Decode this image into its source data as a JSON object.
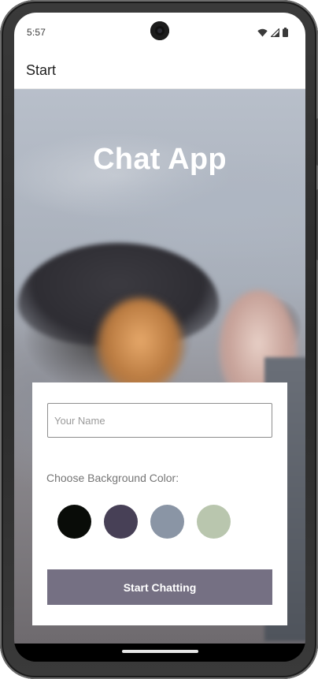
{
  "status_bar": {
    "time": "5:57",
    "icons": [
      "wifi-icon",
      "signal-icon",
      "battery-icon"
    ]
  },
  "app_bar": {
    "title": "Start"
  },
  "hero": {
    "title": "Chat App"
  },
  "form": {
    "name_input": {
      "placeholder": "Your Name",
      "value": ""
    },
    "color_label": "Choose Background Color:",
    "colors": [
      "#090C08",
      "#474056",
      "#8A95A5",
      "#B9C6AE"
    ],
    "start_button": "Start Chatting"
  },
  "theme": {
    "accent": "#757083"
  }
}
